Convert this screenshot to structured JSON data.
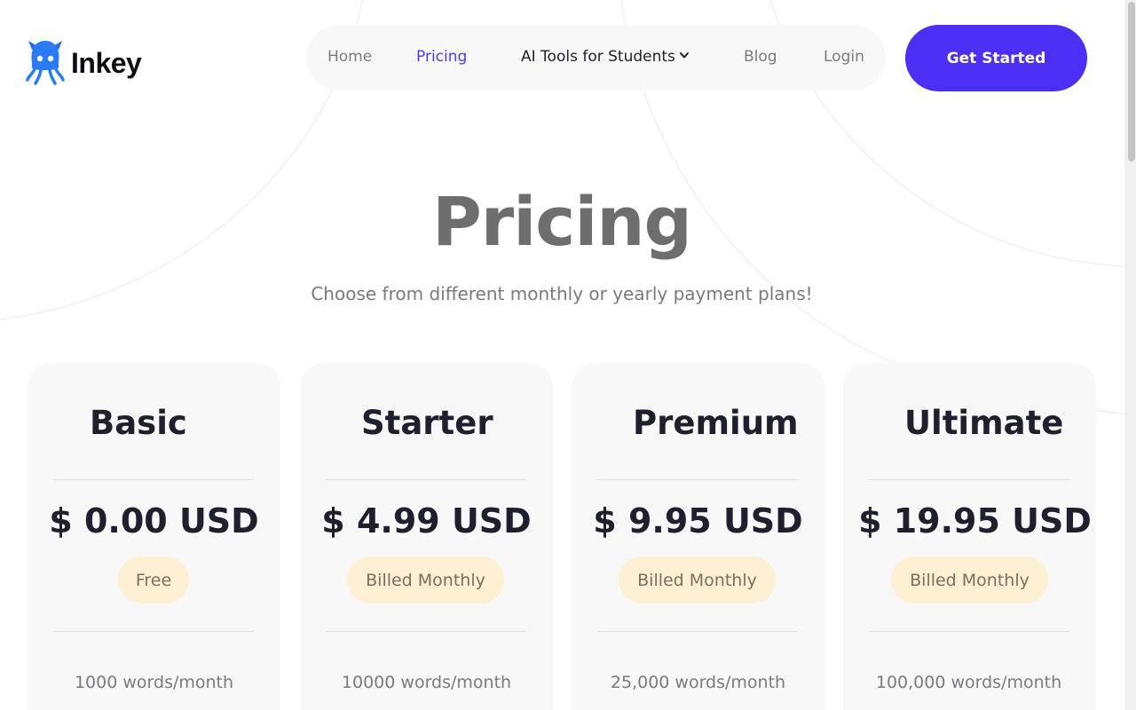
{
  "brand": {
    "name": "Inkey",
    "logo_icon": "squid-icon",
    "accent_color": "#4b2ff5"
  },
  "nav": {
    "items": [
      {
        "label": "Home"
      },
      {
        "label": "Pricing",
        "active": true
      },
      {
        "label": "AI Tools for Students",
        "has_dropdown": true
      },
      {
        "label": "Blog"
      },
      {
        "label": "Login"
      }
    ],
    "cta_label": "Get Started"
  },
  "hero": {
    "title": "Pricing",
    "subtitle": "Choose from different monthly or yearly payment plans!"
  },
  "plans": [
    {
      "name": "Basic",
      "price": "$ 0.00 USD",
      "billing": "Free",
      "words": "1000 words/month"
    },
    {
      "name": "Starter",
      "price": "$ 4.99 USD",
      "billing": "Billed Monthly",
      "words": "10000 words/month"
    },
    {
      "name": "Premium",
      "price": "$ 9.95 USD",
      "billing": "Billed Monthly",
      "words": "25,000 words/month"
    },
    {
      "name": "Ultimate",
      "price": "$ 19.95 USD",
      "billing": "Billed Monthly",
      "words": "100,000 words/month"
    }
  ],
  "colors": {
    "badge_bg": "#fdf0d3",
    "card_bg": "#f8f8f9",
    "active_nav": "#4b3bf0"
  }
}
